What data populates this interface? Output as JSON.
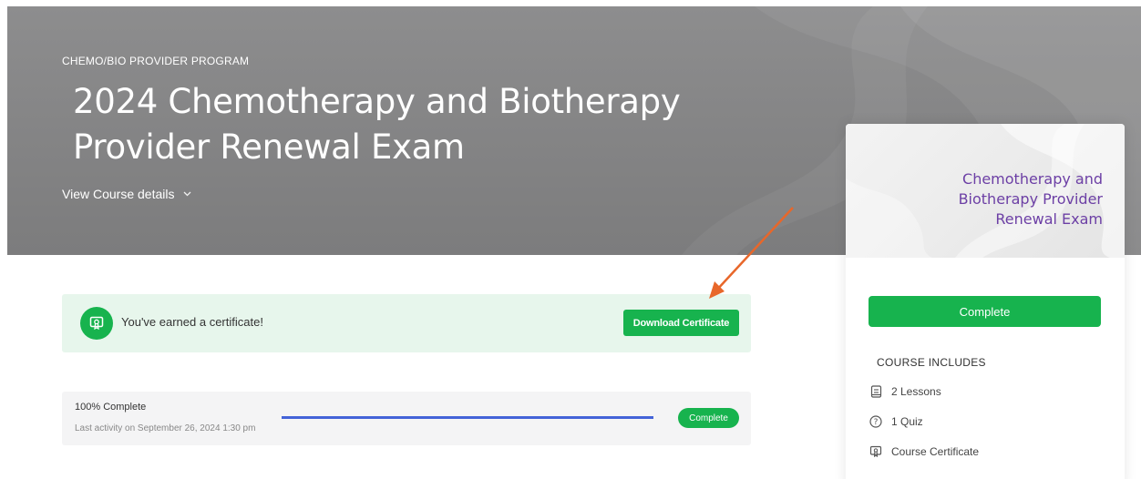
{
  "hero": {
    "eyebrow": "CHEMO/BIO PROVIDER PROGRAM",
    "title": "2024 Chemotherapy and Biotherapy Provider Renewal Exam",
    "details_link": "View Course details"
  },
  "certificate": {
    "message": "You've earned a certificate!",
    "button_label": "Download Certificate"
  },
  "progress": {
    "percent_label": "100% Complete",
    "percent": 100,
    "last_activity": "Last activity on September 26, 2024 1:30 pm",
    "status_badge": "Complete"
  },
  "card": {
    "cover_title": "Chemotherapy and Biotherapy Provider Renewal Exam",
    "button_label": "Complete",
    "includes_heading": "COURSE INCLUDES",
    "includes": [
      {
        "icon": "lessons-icon",
        "label": "2 Lessons"
      },
      {
        "icon": "quiz-icon",
        "label": "1 Quiz"
      },
      {
        "icon": "certificate-icon",
        "label": "Course Certificate"
      }
    ]
  },
  "colors": {
    "accent_green": "#17b34e",
    "progress_blue": "#4363d8",
    "cover_title_purple": "#6c3fa5",
    "annotation_orange": "#e8672a"
  }
}
